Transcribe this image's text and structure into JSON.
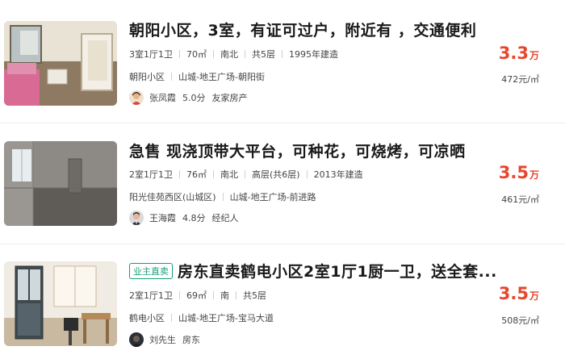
{
  "listings": [
    {
      "title": "朝阳小区，3室，有证可过户，附近有 ，交通便利",
      "tag": "",
      "layout": "3室1厅1卫",
      "area": "70㎡",
      "orientation": "南北",
      "floor": "共5层",
      "year": "1995年建造",
      "community": "朝阳小区",
      "district": "山城-地王广场-朝阳街",
      "agent_name": "张凤霞",
      "agent_score": "5.0分",
      "agency": "友家房产",
      "price": "3.3",
      "price_unit": "万",
      "unit_price": "472元/㎡"
    },
    {
      "title": "急售 现浇顶带大平台，可种花，可烧烤，可凉晒",
      "tag": "",
      "layout": "2室1厅1卫",
      "area": "76㎡",
      "orientation": "南北",
      "floor": "高层(共6层)",
      "year": "2013年建造",
      "community": "阳光佳苑西区(山城区)",
      "district": "山城-地王广场-前进路",
      "agent_name": "王海霞",
      "agent_score": "4.8分",
      "agency": "经纪人",
      "price": "3.5",
      "price_unit": "万",
      "unit_price": "461元/㎡"
    },
    {
      "title": "房东直卖鹤电小区2室1厅1厨一卫，送全套...",
      "tag": "业主直卖",
      "layout": "2室1厅1卫",
      "area": "69㎡",
      "orientation": "南",
      "floor": "共5层",
      "year": "",
      "community": "鹤电小区",
      "district": "山城-地王广场-宝马大道",
      "agent_name": "刘先生",
      "agent_score": "",
      "agency": "房东",
      "price": "3.5",
      "price_unit": "万",
      "unit_price": "508元/㎡"
    }
  ]
}
